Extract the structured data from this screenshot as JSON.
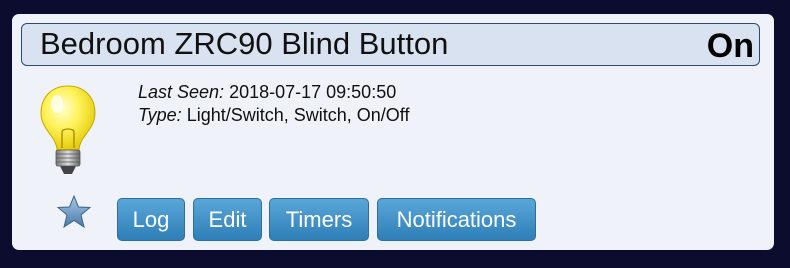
{
  "device": {
    "name": "Bedroom ZRC90 Blind Button",
    "status": "On",
    "last_seen_label": "Last Seen:",
    "last_seen_value": "2018-07-17 09:50:50",
    "type_label": "Type:",
    "type_value": "Light/Switch, Switch, On/Off",
    "icon": "lightbulb-icon",
    "favorite_icon": "star-icon"
  },
  "buttons": {
    "log": "Log",
    "edit": "Edit",
    "timers": "Timers",
    "notifications": "Notifications"
  },
  "colors": {
    "page_background": "#0c0c2e",
    "card_background": "#eff3f9",
    "titlebar_background": "#d8e2f0",
    "button": "#3a8cc6"
  }
}
